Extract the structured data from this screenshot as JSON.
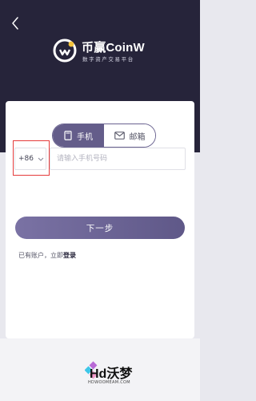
{
  "header": {
    "back_icon": "chevron-left-icon",
    "brand_name": "币赢CoinW",
    "brand_tagline": "数字资产交易平台",
    "background_color": "#26243a"
  },
  "tabs": [
    {
      "label": "手机",
      "icon": "phone-icon",
      "active": true
    },
    {
      "label": "邮箱",
      "icon": "envelope-icon",
      "active": false
    }
  ],
  "phone_form": {
    "country_code": "+86",
    "country_code_icon": "chevron-down-icon",
    "phone_placeholder": "请输入手机号码",
    "next_label": "下一步"
  },
  "footer": {
    "account_prompt": "已有账户，立即",
    "login_link": "登录"
  },
  "watermark": {
    "text": "Hd沃梦",
    "subtext": "HDWOOMEAM.COM"
  },
  "colors": {
    "accent": "#645d8a",
    "highlight": "#e53b3b"
  }
}
